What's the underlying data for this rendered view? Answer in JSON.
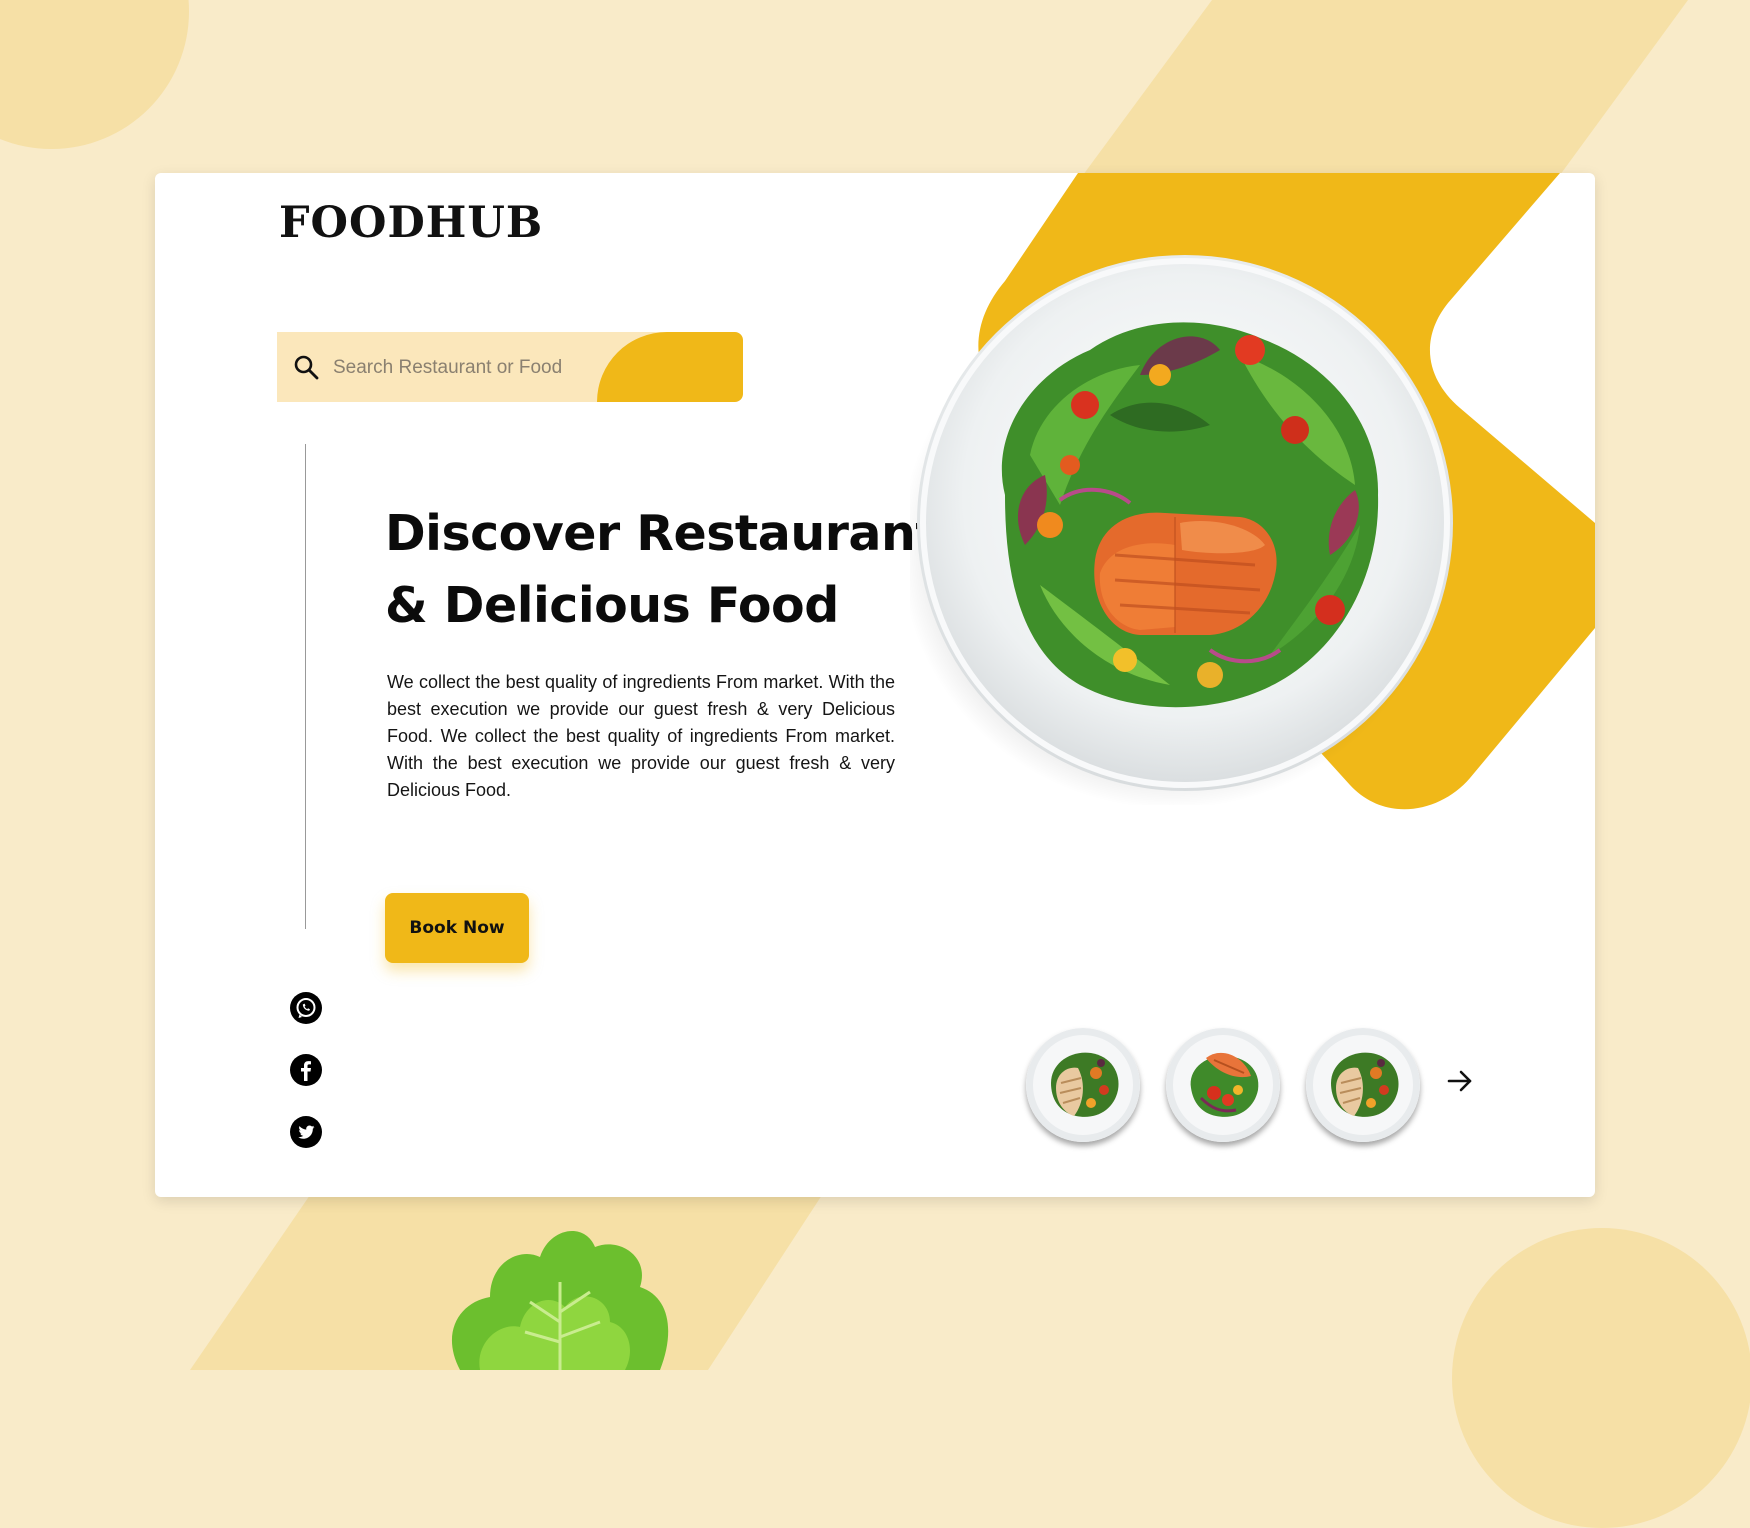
{
  "brand": {
    "logo": "FOODHUB"
  },
  "search": {
    "placeholder": "Search Restaurant or Food"
  },
  "hero": {
    "headline_line1": "Discover Restaurant",
    "headline_line2": "&  Delicious Food",
    "description": "We collect the best quality of ingredients From market. With the best execution we provide our guest fresh & very Delicious Food. We collect the best quality of ingredients From market. With the best execution we provide our guest fresh & very Delicious Food.",
    "cta_label": "Book Now"
  },
  "social": [
    "whatsapp-icon",
    "facebook-icon",
    "twitter-icon"
  ],
  "carousel": {
    "items": [
      "chicken-salad-plate",
      "salmon-salad-plate",
      "chicken-salad-plate"
    ]
  },
  "colors": {
    "accent": "#f0b818",
    "background": "#f9ebc9",
    "card": "#ffffff",
    "search_bg": "#fbe7bb"
  }
}
